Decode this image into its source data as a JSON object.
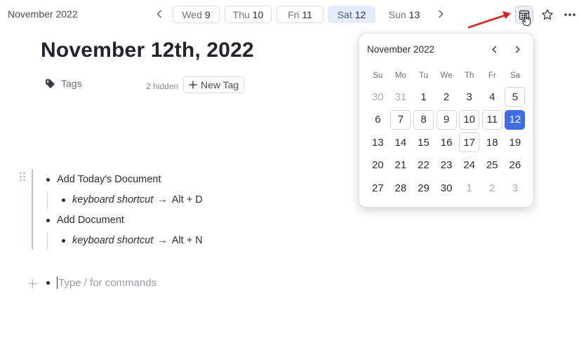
{
  "header": {
    "month_label": "November 2022",
    "day_tabs": [
      {
        "weekday": "Wed",
        "day": "9"
      },
      {
        "weekday": "Thu",
        "day": "10"
      },
      {
        "weekday": "Fri",
        "day": "11"
      },
      {
        "weekday": "Sat",
        "day": "12"
      },
      {
        "weekday": "Sun",
        "day": "13"
      }
    ],
    "selected_tab": "Sat 12",
    "icons": [
      "chevron-left-icon",
      "chevron-right-icon",
      "calendar-icon",
      "star-icon",
      "more-icon"
    ]
  },
  "page": {
    "title": "November 12th, 2022",
    "tags_label": "Tags",
    "hidden_count": "2 hidden",
    "new_tag_label": "New Tag"
  },
  "outline": {
    "items": [
      {
        "text": "Add Today's Document",
        "child": {
          "label": "keyboard shortcut",
          "arrow": "→",
          "shortcut": "Alt + D"
        }
      },
      {
        "text": "Add Document",
        "child": {
          "label": "keyboard shortcut",
          "arrow": "→",
          "shortcut": "Alt + N"
        }
      }
    ],
    "command_placeholder": "Type / for commands"
  },
  "calendar": {
    "title": "November 2022",
    "weekdays": [
      "Su",
      "Mo",
      "Tu",
      "We",
      "Th",
      "Fr",
      "Sa"
    ],
    "weeks": [
      [
        "30",
        "31",
        "1",
        "2",
        "3",
        "4",
        "5"
      ],
      [
        "6",
        "7",
        "8",
        "9",
        "10",
        "11",
        "12"
      ],
      [
        "13",
        "14",
        "15",
        "16",
        "17",
        "18",
        "19"
      ],
      [
        "20",
        "21",
        "22",
        "23",
        "24",
        "25",
        "26"
      ],
      [
        "27",
        "28",
        "29",
        "30",
        "1",
        "2",
        "3"
      ]
    ],
    "selected_day": "12",
    "accent_color": "#3d6ee8"
  },
  "colors": {
    "accent": "#3d6ee8",
    "active_tab_bg": "#e6ebfb",
    "annotation_arrow": "#e02020"
  }
}
